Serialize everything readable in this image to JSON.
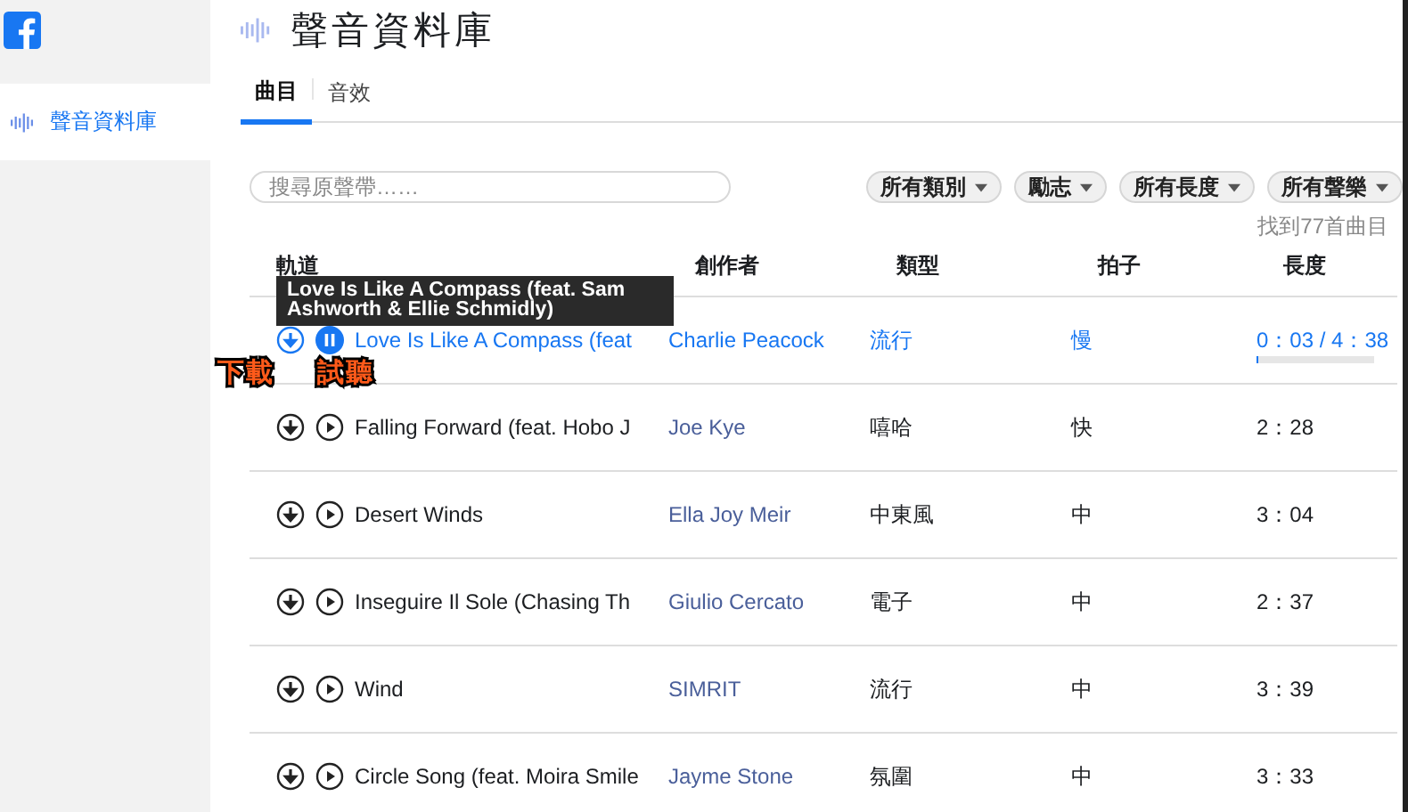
{
  "sidebar": {
    "items": [
      {
        "label": "聲音資料庫",
        "selected": true
      }
    ]
  },
  "page": {
    "title": "聲音資料庫"
  },
  "tabs": [
    {
      "label": "曲目",
      "selected": true
    },
    {
      "label": "音效",
      "selected": false
    }
  ],
  "search": {
    "placeholder": "搜尋原聲帶……"
  },
  "filters": [
    {
      "label": "所有類別"
    },
    {
      "label": "勵志"
    },
    {
      "label": "所有長度"
    },
    {
      "label": "所有聲樂"
    }
  ],
  "result_count": "找到77首曲目",
  "table": {
    "columns": [
      "軌道",
      "創作者",
      "類型",
      "拍子",
      "長度"
    ],
    "rows": [
      {
        "title": "Love Is Like A Compass (feat",
        "artist": "Charlie Peacock",
        "genre": "流行",
        "tempo": "慢",
        "length": "0：03 / 4：38",
        "playing": true,
        "level": 0.01
      },
      {
        "title": "Falling Forward (feat. Hobo J",
        "artist": "Joe Kye",
        "genre": "嘻哈",
        "tempo": "快",
        "length": "2：28",
        "playing": false
      },
      {
        "title": "Desert Winds",
        "artist": "Ella Joy Meir",
        "genre": "中東風",
        "tempo": "中",
        "length": "3：04",
        "playing": false
      },
      {
        "title": "Inseguire Il Sole (Chasing Th",
        "artist": "Giulio Cercato",
        "genre": "電子",
        "tempo": "中",
        "length": "2：37",
        "playing": false
      },
      {
        "title": "Wind",
        "artist": "SIMRIT",
        "genre": "流行",
        "tempo": "中",
        "length": "3：39",
        "playing": false
      },
      {
        "title": "Circle Song (feat. Moira Smile",
        "artist": "Jayme Stone",
        "genre": "氛圍",
        "tempo": "中",
        "length": "3：33",
        "playing": false
      }
    ]
  },
  "tooltip": "Love Is Like A Compass (feat. Sam Ashworth & Ellie Schmidly)",
  "callouts": [
    "下載",
    "試聽"
  ]
}
